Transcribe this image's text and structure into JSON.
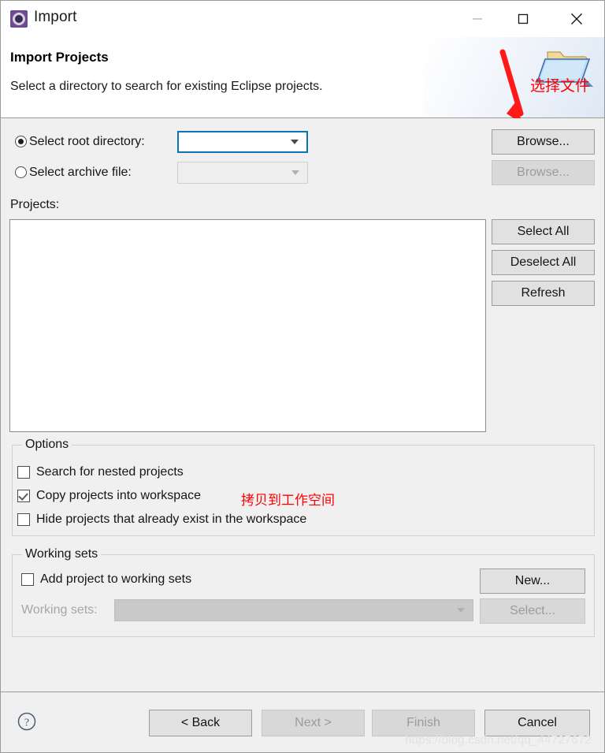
{
  "window": {
    "title": "Import",
    "icon": "eclipse-import-icon",
    "controls": {
      "minimize": "minimize-icon",
      "maximize": "maximize-icon",
      "close": "close-icon"
    }
  },
  "header": {
    "title": "Import Projects",
    "description": "Select a directory to search for existing Eclipse projects.",
    "banner_icon": "folder-import-icon"
  },
  "annotations": {
    "select_file": "选择文件",
    "copy_to_workspace": "拷贝到工作空间",
    "arrow": "red-down-right-arrow"
  },
  "source": {
    "root_directory": {
      "radio_label": "Select root directory:",
      "selected": true,
      "value": "",
      "browse_label": "Browse...",
      "browse_enabled": true
    },
    "archive_file": {
      "radio_label": "Select archive file:",
      "selected": false,
      "value": "",
      "browse_label": "Browse...",
      "browse_enabled": false
    }
  },
  "projects": {
    "label": "Projects:",
    "items": [],
    "buttons": [
      {
        "label": "Select All",
        "enabled": true
      },
      {
        "label": "Deselect All",
        "enabled": true
      },
      {
        "label": "Refresh",
        "enabled": true
      }
    ]
  },
  "options": {
    "title": "Options",
    "items": [
      {
        "label": "Search for nested projects",
        "checked": false
      },
      {
        "label": "Copy projects into workspace",
        "checked": true
      },
      {
        "label": "Hide projects that already exist in the workspace",
        "checked": false
      }
    ]
  },
  "working_sets": {
    "title": "Working sets",
    "add_checkbox_label": "Add project to working sets",
    "add_checked": false,
    "new_button": "New...",
    "combo_label": "Working sets:",
    "combo_value": "",
    "combo_enabled": false,
    "select_button": "Select...",
    "select_enabled": false
  },
  "footer": {
    "help_icon": "help-question-icon",
    "buttons": [
      {
        "label": "< Back",
        "enabled": true
      },
      {
        "label": "Next >",
        "enabled": false
      },
      {
        "label": "Finish",
        "enabled": false
      },
      {
        "label": "Cancel",
        "enabled": true
      }
    ]
  },
  "watermark": "https://blog.csdn.net/qq_44727672"
}
